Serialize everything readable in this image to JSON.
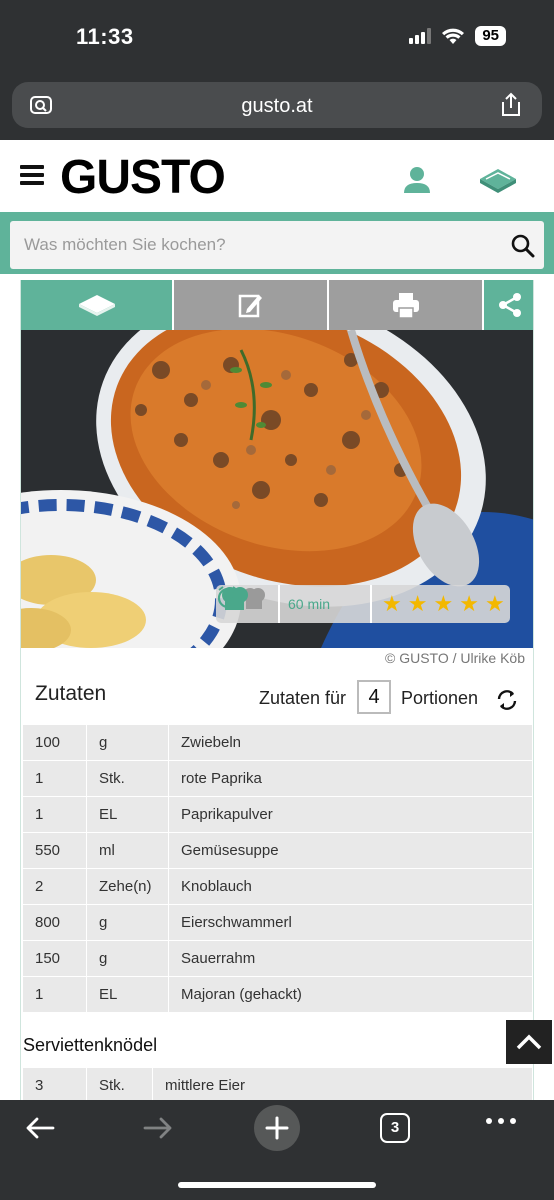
{
  "status_bar": {
    "time": "11:33",
    "battery": "95"
  },
  "browser": {
    "url": "gusto.at",
    "tab_count": "3"
  },
  "site": {
    "logo": "GUSTO"
  },
  "search": {
    "placeholder": "Was möchten Sie kochen?"
  },
  "recipe": {
    "time": "60 min",
    "rating_stars": 5,
    "credit": "© GUSTO / Ulrike Köb",
    "ingredients_heading": "Zutaten",
    "portions_label_before": "Zutaten für",
    "portions_value": "4",
    "portions_label_after": "Portionen",
    "ingredients": [
      {
        "qty": "100",
        "unit": "g",
        "name": "Zwiebeln"
      },
      {
        "qty": "1",
        "unit": "Stk.",
        "name": "rote Paprika"
      },
      {
        "qty": "1",
        "unit": "EL",
        "name": "Paprikapulver"
      },
      {
        "qty": "550",
        "unit": "ml",
        "name": "Gemüsesuppe"
      },
      {
        "qty": "2",
        "unit": "Zehe(n)",
        "name": "Knoblauch"
      },
      {
        "qty": "800",
        "unit": "g",
        "name": "Eierschwammerl"
      },
      {
        "qty": "150",
        "unit": "g",
        "name": "Sauerrahm"
      },
      {
        "qty": "1",
        "unit": "EL",
        "name": "Majoran (gehackt)"
      }
    ],
    "section2_title": "Serviettenknödel",
    "section2_ingredients": [
      {
        "qty": "3",
        "unit": "Stk.",
        "name": "mittlere Eier"
      }
    ]
  },
  "colors": {
    "brand_green": "#5fb39a",
    "star": "#f3b800",
    "chrome": "#2f3133"
  }
}
